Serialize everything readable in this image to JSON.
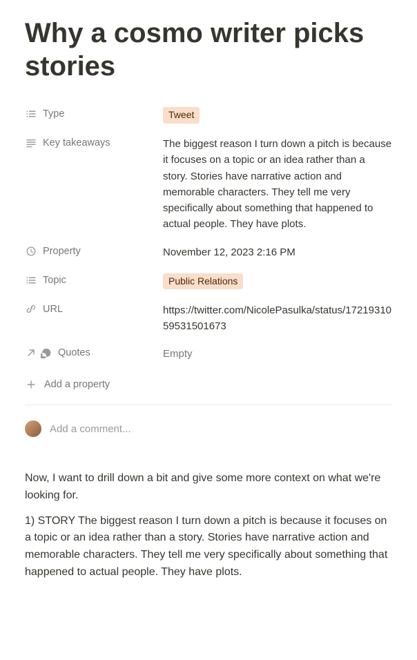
{
  "title": "Why a cosmo writer picks stories",
  "properties": {
    "type": {
      "label": "Type",
      "tag": "Tweet"
    },
    "key_takeaways": {
      "label": "Key takeaways",
      "value": "The biggest reason I turn down a pitch is because it focuses on a topic or an idea rather than a story. Stories have narrative action and memorable characters. They tell me very specifically about something that happened to actual people. They have plots."
    },
    "property_date": {
      "label": "Property",
      "value": "November 12, 2023 2:16 PM"
    },
    "topic": {
      "label": "Topic",
      "tag": "Public Relations"
    },
    "url": {
      "label": "URL",
      "value": "https://twitter.com/NicolePasulka/status/1721931059531501673"
    },
    "quotes": {
      "label": "Quotes",
      "value": "Empty"
    }
  },
  "add_property_label": "Add a property",
  "comment_placeholder": "Add a comment...",
  "body": {
    "p1": "Now, I want to drill down a bit and give some more context on what we're looking for.",
    "p2": "1) STORY The biggest reason I turn down a pitch is because it focuses on a topic or an idea rather than a story. Stories have narrative action and memorable characters. They tell me very specifically about something that happened to actual people. They have plots."
  }
}
